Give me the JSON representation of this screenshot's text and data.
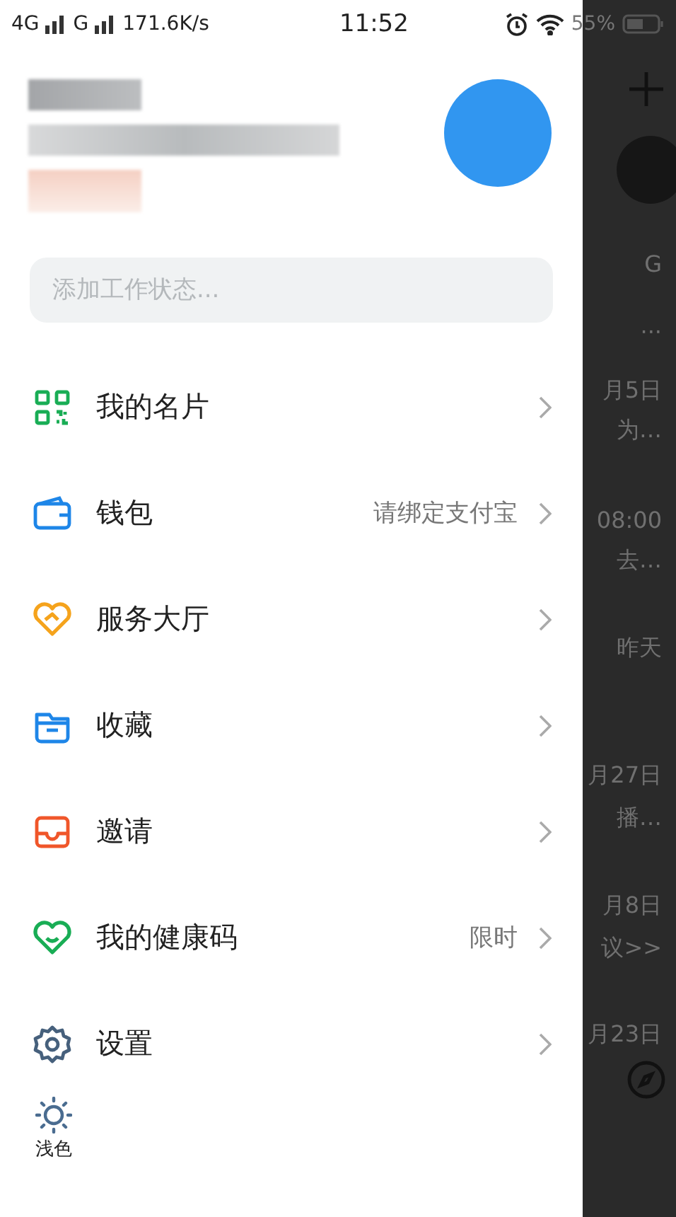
{
  "status_bar": {
    "network_1": "4G",
    "network_2": "G",
    "speed": "171.6K/s",
    "time": "11:52",
    "battery": "55%"
  },
  "status_input": {
    "placeholder": "添加工作状态..."
  },
  "menu": [
    {
      "label": "我的名片"
    },
    {
      "label": "钱包",
      "detail": "请绑定支付宝"
    },
    {
      "label": "服务大厅"
    },
    {
      "label": "收藏"
    },
    {
      "label": "邀请"
    },
    {
      "label": "我的健康码",
      "detail": "限时"
    },
    {
      "label": "设置"
    }
  ],
  "theme_toggle": {
    "label": "浅色"
  },
  "background_list": [
    "G",
    "···",
    "月5日",
    "为…",
    "08:00",
    "去…",
    "昨天",
    "月27日",
    "播…",
    "月8日",
    "议>>",
    "月23日"
  ]
}
